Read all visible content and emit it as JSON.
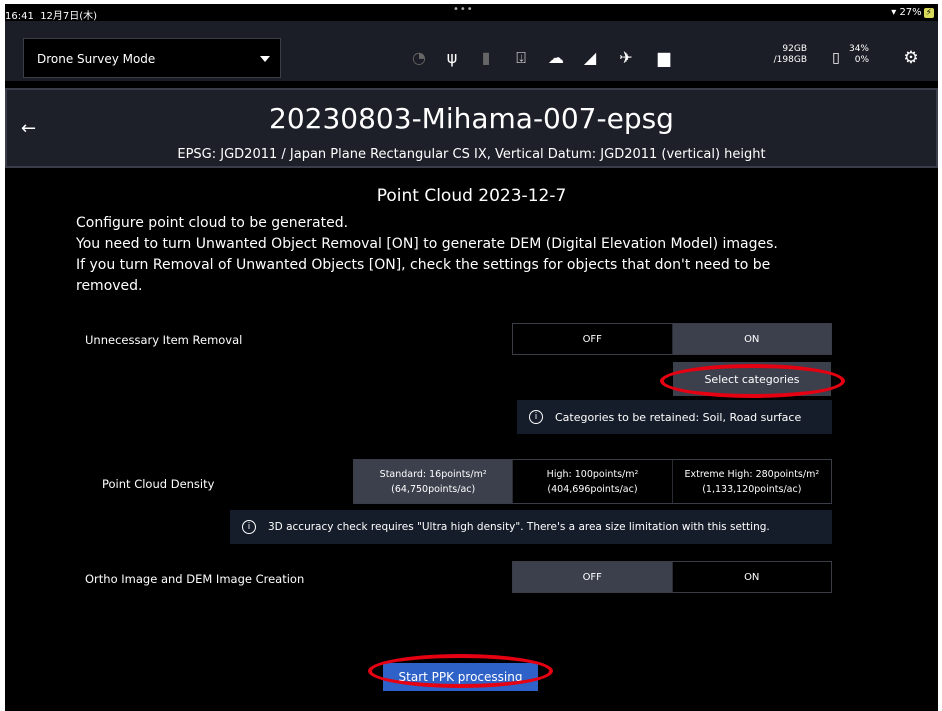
{
  "status": {
    "time": "16:41",
    "date": "12月7日(木)",
    "dots": "•••",
    "wifi_battery": "27%"
  },
  "toolbar": {
    "mode": "Drone Survey Mode",
    "storage_used": "92GB",
    "storage_total": "/198GB",
    "battery_pct": "34%",
    "battery_sub": "0%"
  },
  "header": {
    "back": "←",
    "title": "20230803-Mihama-007-epsg",
    "subtitle": "EPSG: JGD2011 / Japan Plane Rectangular CS IX, Vertical Datum: JGD2011 (vertical) height"
  },
  "section_title": "Point Cloud 2023-12-7",
  "description": [
    "Configure point cloud to be generated.",
    "You need to turn Unwanted Object Removal [ON] to generate DEM (Digital Elevation Model) images.",
    "If you turn Removal of Unwanted Objects [ON], check the settings for objects that don't need to be",
    "removed."
  ],
  "removal": {
    "label": "Unnecessary Item Removal",
    "off": "OFF",
    "on": "ON",
    "selected": "ON",
    "select_categories": "Select categories",
    "info": "Categories to be retained: Soil, Road surface"
  },
  "density": {
    "label": "Point Cloud Density",
    "options": [
      {
        "line1": "Standard: 16points/m²",
        "line2": "(64,750points/ac)"
      },
      {
        "line1": "High: 100points/m²",
        "line2": "(404,696points/ac)"
      },
      {
        "line1": "Extreme High: 280points/m²",
        "line2": "(1,133,120points/ac)"
      }
    ],
    "selected": "Standard",
    "info": "3D accuracy check requires \"Ultra high density\". There's a area size limitation with this setting."
  },
  "ortho": {
    "label": "Ortho Image and DEM Image Creation",
    "off": "OFF",
    "on": "ON",
    "selected": "OFF"
  },
  "start_button": "Start PPK processing",
  "colors": {
    "accent": "#2f62c9",
    "highlight": "#e50012",
    "selected": "#3c404c"
  },
  "icons": [
    "clock-icon",
    "usb-icon",
    "sd-card-icon",
    "download-icon",
    "cloud-icon",
    "signal-icon",
    "satellite-icon",
    "folder-icon",
    "battery-icon",
    "gear-icon",
    "info-icon",
    "back-arrow-icon"
  ]
}
